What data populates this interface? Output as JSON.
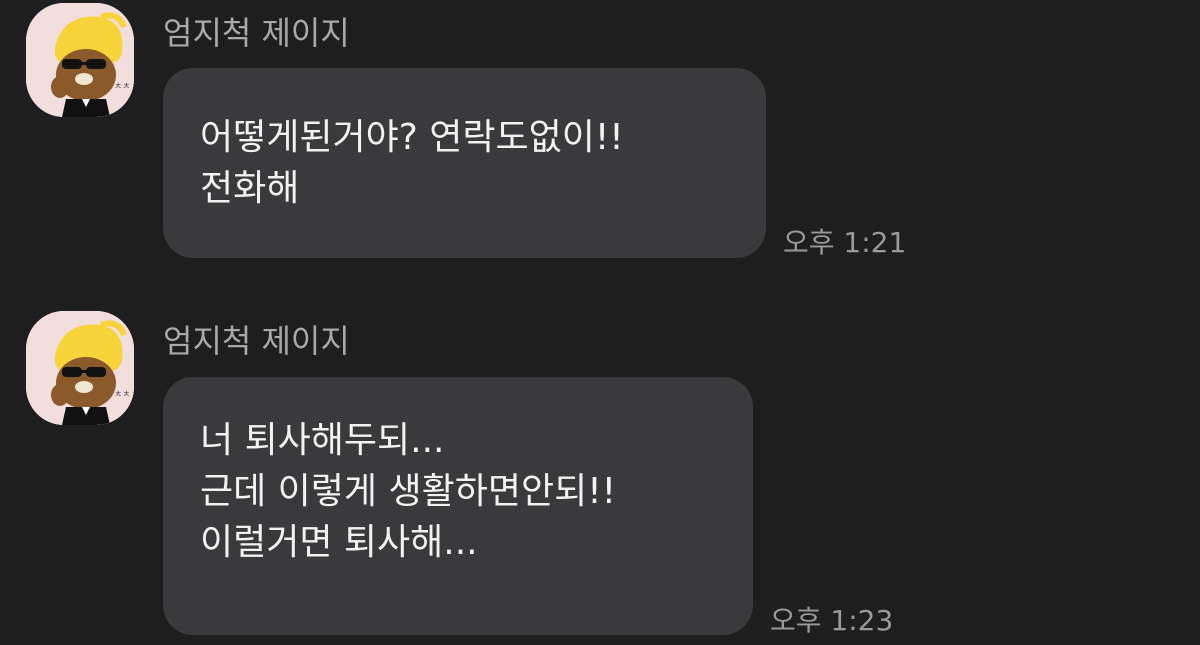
{
  "messages": [
    {
      "sender": "엄지척 제이지",
      "lines": [
        "어떻게된거야? 연락도없이!!",
        "전화해"
      ],
      "time": "오후 1:21",
      "avatar_icon": "ryan-thumbs-up-avatar-icon"
    },
    {
      "sender": "엄지척 제이지",
      "lines": [
        "너 퇴사해두되...",
        "근데 이렇게 생활하면안되!!",
        "이럴거면 퇴사해..."
      ],
      "time": "오후 1:23",
      "avatar_icon": "ryan-thumbs-up-avatar-icon"
    }
  ],
  "colors": {
    "background": "#1e1e1e",
    "bubble": "#3a3a3c",
    "text": "#f2f2f2",
    "secondary_text": "#a9a9a9",
    "avatar_bg": "#f3dede"
  }
}
